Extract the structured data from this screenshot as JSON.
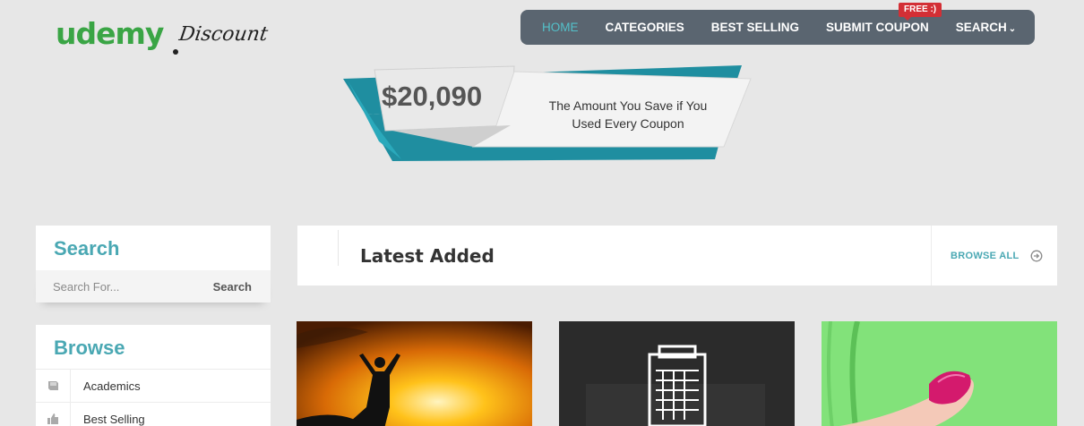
{
  "logo": {
    "brand": "udemy",
    "suffix": "Discount"
  },
  "nav": {
    "items": [
      "HOME",
      "CATEGORIES",
      "BEST SELLING",
      "SUBMIT COUPON",
      "SEARCH"
    ],
    "badge": "FREE :)"
  },
  "banner": {
    "amount": "$20,090",
    "caption": "The Amount You Save if You Used Every Coupon"
  },
  "sidebar": {
    "search": {
      "title": "Search",
      "placeholder": "Search For...",
      "button": "Search"
    },
    "browse": {
      "title": "Browse",
      "items": [
        {
          "label": "Academics",
          "icon": "book-icon"
        },
        {
          "label": "Best Selling",
          "icon": "thumbs-up-icon"
        }
      ]
    }
  },
  "main": {
    "section_title": "Latest Added",
    "browse_all": "BROWSE ALL"
  },
  "colors": {
    "accent": "#4aa8b3",
    "nav_bg": "#5a6570",
    "logo_green": "#3aa545",
    "badge_red": "#d32f35"
  }
}
